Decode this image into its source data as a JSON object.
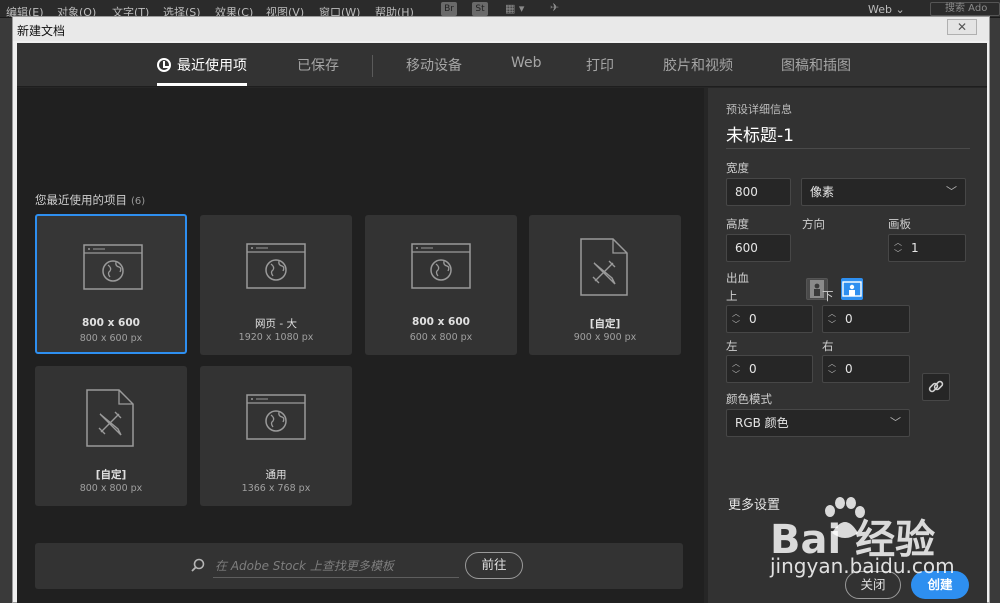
{
  "menubar": {
    "items": [
      "编辑(E)",
      "对象(O)",
      "文字(T)",
      "选择(S)",
      "效果(C)",
      "视图(V)",
      "窗口(W)",
      "帮助(H)"
    ],
    "app_icons": [
      "Br",
      "St"
    ],
    "workspace": "Web",
    "search_placeholder": "搜索 Ado"
  },
  "dialog": {
    "title": "新建文档",
    "close_symbol": "✕"
  },
  "tabs": [
    {
      "label": "最近使用项",
      "active": true
    },
    {
      "label": "已保存"
    },
    {
      "label": "移动设备"
    },
    {
      "label": "Web"
    },
    {
      "label": "打印"
    },
    {
      "label": "胶片和视频"
    },
    {
      "label": "图稿和插图"
    }
  ],
  "recent": {
    "heading": "您最近使用的项目",
    "count": "(6)",
    "items": [
      {
        "name": "800 x 600",
        "dims": "800 x 600 px",
        "icon": "web-page-icon",
        "selected": true
      },
      {
        "name": "网页 - 大",
        "dims": "1920 x 1080 px",
        "icon": "web-page-icon"
      },
      {
        "name": "800 x 600",
        "dims": "600 x 800 px",
        "icon": "web-page-icon"
      },
      {
        "name": "[自定]",
        "dims": "900 x 900 px",
        "icon": "custom-document-icon"
      },
      {
        "name": "[自定]",
        "dims": "800 x 800 px",
        "icon": "custom-document-icon"
      },
      {
        "name": "通用",
        "dims": "1366 x 768 px",
        "icon": "web-page-icon"
      }
    ]
  },
  "stock": {
    "placeholder": "在 Adobe Stock 上查找更多模板",
    "go_label": "前往"
  },
  "details": {
    "section_title": "预设详细信息",
    "doc_name": "未标题-1",
    "width_label": "宽度",
    "width_value": "800",
    "unit_value": "像素",
    "height_label": "高度",
    "height_value": "600",
    "orientation_label": "方向",
    "artboards_label": "画板",
    "artboards_value": "1",
    "bleed_label": "出血",
    "bleed_top_label": "上",
    "bleed_top_value": "0",
    "bleed_bottom_label": "下",
    "bleed_bottom_value": "0",
    "bleed_left_label": "左",
    "bleed_left_value": "0",
    "bleed_right_label": "右",
    "bleed_right_value": "0",
    "color_mode_label": "颜色模式",
    "color_mode_value": "RGB 颜色",
    "more_settings": "更多设置",
    "close_label": "关闭",
    "create_label": "创建"
  },
  "watermark": {
    "brand": "Bai  经验",
    "url": "jingyan.baidu.com"
  },
  "colors": {
    "accent": "#2e8ff0",
    "panel": "#323232",
    "canvas": "#202020"
  }
}
